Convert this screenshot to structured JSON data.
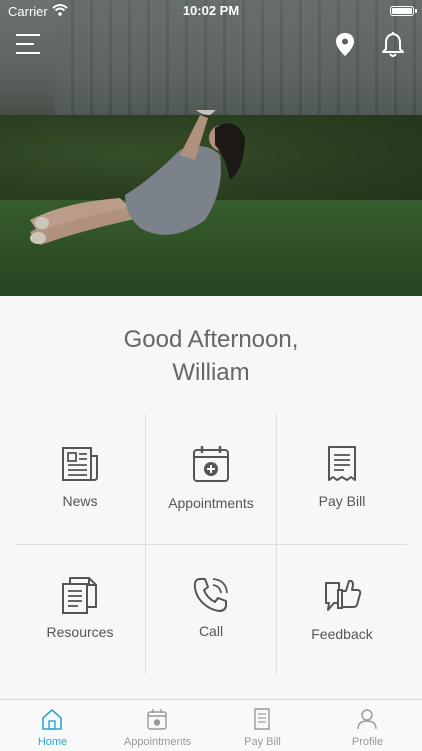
{
  "status_bar": {
    "carrier": "Carrier",
    "time": "10:02 PM"
  },
  "greeting": {
    "line1": "Good Afternoon,",
    "line2": "William"
  },
  "grid": [
    {
      "label": "News",
      "icon": "newspaper-icon"
    },
    {
      "label": "Appointments",
      "icon": "calendar-add-icon"
    },
    {
      "label": "Pay Bill",
      "icon": "receipt-icon"
    },
    {
      "label": "Resources",
      "icon": "documents-icon"
    },
    {
      "label": "Call",
      "icon": "phone-icon"
    },
    {
      "label": "Feedback",
      "icon": "thumbs-up-chat-icon"
    }
  ],
  "tabs": [
    {
      "label": "Home",
      "icon": "home-icon",
      "active": true
    },
    {
      "label": "Appointments",
      "icon": "calendar-icon",
      "active": false
    },
    {
      "label": "Pay Bill",
      "icon": "bill-icon",
      "active": false
    },
    {
      "label": "Profile",
      "icon": "person-icon",
      "active": false
    }
  ],
  "colors": {
    "accent": "#29a6d8",
    "icon_stroke": "#555555",
    "tab_inactive": "#999999"
  }
}
